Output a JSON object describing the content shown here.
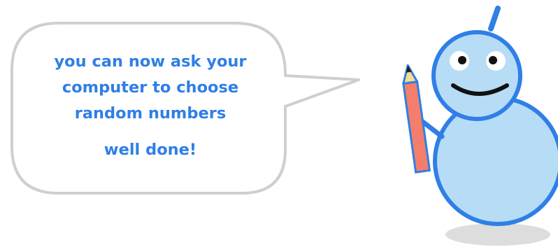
{
  "speech_bubble": {
    "lines": [
      "you can now ask your",
      "computer to choose",
      "random numbers"
    ],
    "praise": "well done!"
  },
  "colors": {
    "text": "#2f7fe6",
    "bubble_border": "#cfcfcf",
    "robot_body": "#b7dcf6",
    "robot_outline": "#2f7fe6",
    "pencil": "#f47e6b",
    "shadow": "#dddddd"
  }
}
